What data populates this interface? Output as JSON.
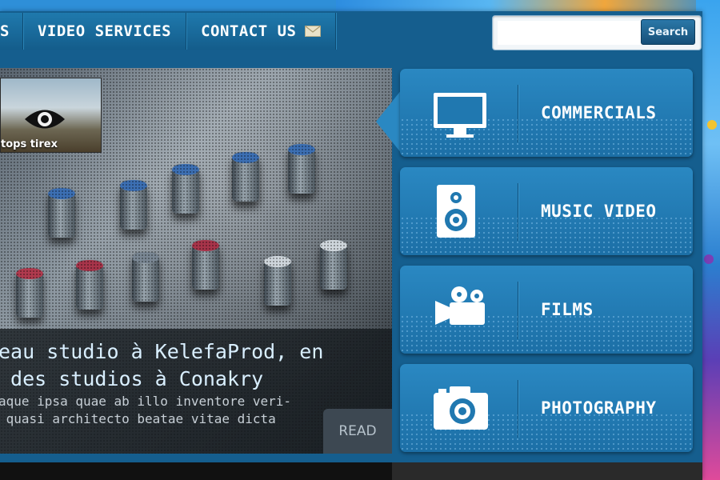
{
  "nav": {
    "items": [
      {
        "label": "S"
      },
      {
        "label": "VIDEO SERVICES"
      },
      {
        "label": "CONTACT US"
      }
    ]
  },
  "search": {
    "placeholder": "",
    "button_label": "Search"
  },
  "slider": {
    "thumb_label": "tops tirex",
    "title": "eau studio à KelefaProd, en\n des studios à Conakry",
    "text": "aque ipsa quae ab illo inventore veri-\n quasi architecto beatae vitae dicta",
    "read_label": "READ"
  },
  "services": [
    {
      "label": "COMMERCIALS",
      "icon": "monitor-icon"
    },
    {
      "label": "MUSIC VIDEO",
      "icon": "speaker-icon"
    },
    {
      "label": "FILMS",
      "icon": "video-camera-icon"
    },
    {
      "label": "PHOTOGRAPHY",
      "icon": "photo-camera-icon"
    }
  ],
  "colors": {
    "panel": "#155e8e",
    "nav": "#1f79ad",
    "service_tile": "#2a88c2"
  }
}
